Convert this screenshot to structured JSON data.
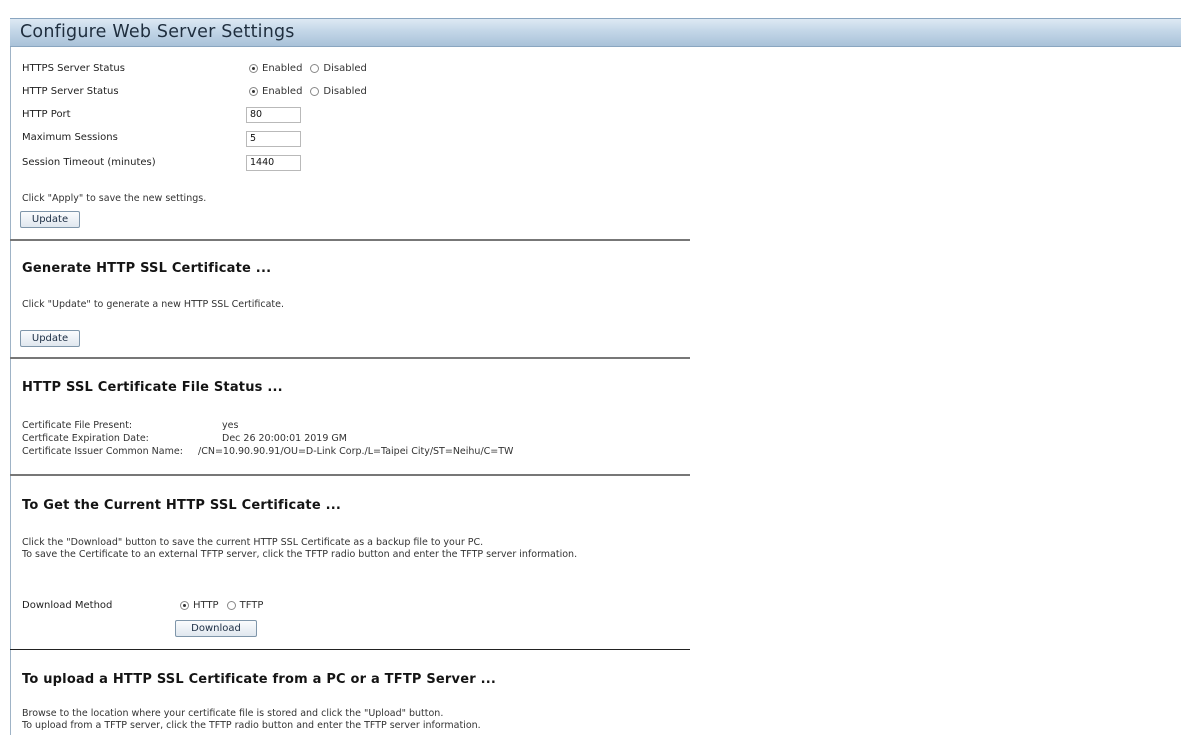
{
  "page": {
    "title": "Configure Web Server Settings"
  },
  "web_server": {
    "https_status": {
      "label": "HTTPS Server Status",
      "options": [
        "Enabled",
        "Disabled"
      ],
      "selected": "Enabled"
    },
    "http_status": {
      "label": "HTTP Server Status",
      "options": [
        "Enabled",
        "Disabled"
      ],
      "selected": "Enabled"
    },
    "http_port": {
      "label": "HTTP Port",
      "value": "80"
    },
    "max_sessions": {
      "label": "Maximum Sessions",
      "value": "5"
    },
    "session_timeout": {
      "label": "Session Timeout (minutes)",
      "value": "1440"
    },
    "hint": "Click \"Apply\" to save the new settings.",
    "update_label": "Update"
  },
  "generate_cert": {
    "heading": "Generate HTTP SSL Certificate ...",
    "hint": "Click \"Update\" to generate a new HTTP SSL Certificate.",
    "update_label": "Update"
  },
  "cert_status": {
    "heading": "HTTP SSL Certificate File Status ...",
    "rows": [
      {
        "label": "Certificate File Present:",
        "value": "yes"
      },
      {
        "label": "Certficate Expiration Date:",
        "value": "Dec 26 20:00:01 2019 GM"
      },
      {
        "label": "Certificate Issuer Common Name:",
        "value": "/CN=10.90.90.91/OU=D-Link Corp./L=Taipei City/ST=Neihu/C=TW"
      }
    ]
  },
  "get_cert": {
    "heading": "To Get the Current HTTP SSL Certificate ...",
    "line1": "Click the \"Download\" button to save the current HTTP SSL Certificate as a backup file to your PC.",
    "line2": "To save the Certificate to an external TFTP server, click the TFTP radio button and enter the TFTP server information.",
    "method_label": "Download Method",
    "options": [
      "HTTP",
      "TFTP"
    ],
    "selected": "HTTP",
    "download_label": "Download"
  },
  "upload_cert": {
    "heading": "To upload a HTTP SSL Certificate from a PC or a TFTP Server ...",
    "line1": "Browse to the location where your certificate file is stored and click the \"Upload\" button.",
    "line2": "To upload from a TFTP server, click the TFTP radio button and enter the TFTP server information."
  }
}
